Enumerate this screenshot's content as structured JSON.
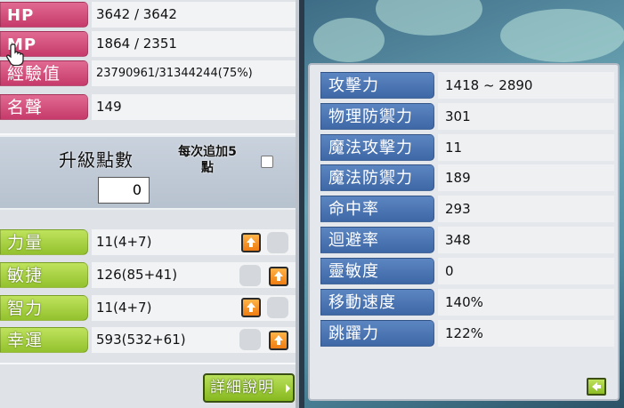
{
  "basic_stats": [
    {
      "label": "HP",
      "value": "3642 / 3642"
    },
    {
      "label": "MP",
      "value": "1864 / 2351"
    },
    {
      "label": "經驗值",
      "value": "23790961/31344244(75%)"
    },
    {
      "label": "名聲",
      "value": "149"
    }
  ],
  "ability_points": {
    "title": "升級點數",
    "value": "0",
    "auto_line1": "每次追加5",
    "auto_line2": "點",
    "auto_checked": false
  },
  "primary_stats": [
    {
      "label": "力量",
      "value": "11(4+7)"
    },
    {
      "label": "敏捷",
      "value": "126(85+41)"
    },
    {
      "label": "智力",
      "value": "11(4+7)"
    },
    {
      "label": "幸運",
      "value": "593(532+61)"
    }
  ],
  "detail_button": "詳細說明",
  "detail_stats": [
    {
      "label": "攻擊力",
      "value": "1418 ~ 2890"
    },
    {
      "label": "物理防禦力",
      "value": "301"
    },
    {
      "label": "魔法攻擊力",
      "value": "11"
    },
    {
      "label": "魔法防禦力",
      "value": "189"
    },
    {
      "label": "命中率",
      "value": "293"
    },
    {
      "label": "迴避率",
      "value": "348"
    },
    {
      "label": "靈敏度",
      "value": "0"
    },
    {
      "label": "移動速度",
      "value": "140%"
    },
    {
      "label": "跳躍力",
      "value": "122%"
    }
  ],
  "colors": {
    "pink_label": "#c63a6a",
    "green_label": "#93c12d",
    "blue_label": "#3e67a6",
    "up_button": "#ef7c12"
  }
}
